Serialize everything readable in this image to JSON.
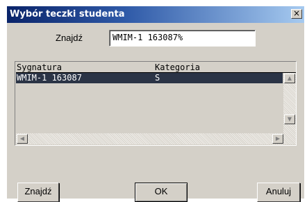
{
  "dialog": {
    "title": "Wybór teczki studenta",
    "close_glyph": "×",
    "search_label": "Znajdź",
    "search_value": "WMIM-1 163087%"
  },
  "list": {
    "columns": [
      "Sygnatura",
      "Kategoria"
    ],
    "rows": [
      {
        "sygnatura": "WMIM-1 163087",
        "kategoria": "S"
      }
    ]
  },
  "buttons": {
    "find": "Znajdź",
    "ok": "OK",
    "cancel": "Anuluj"
  },
  "colors": {
    "title_start": "#0a246a",
    "title_end": "#a6caf0",
    "selection": "#2b3446",
    "face": "#d4d0c8"
  }
}
